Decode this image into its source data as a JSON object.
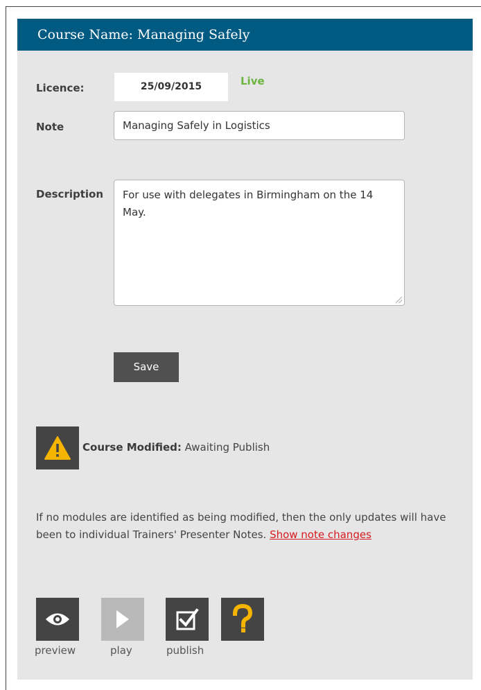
{
  "header": {
    "title": "Course Name: Managing Safely"
  },
  "licence": {
    "label": "Licence:",
    "date": "25/09/2015",
    "status": "Live",
    "status_color": "#6cb33f"
  },
  "note": {
    "label": "Note",
    "value": "Managing Safely in Logistics"
  },
  "description": {
    "label": "Description",
    "value": "For use with delegates in Birmingham on the 14 May."
  },
  "save": {
    "label": "Save"
  },
  "status": {
    "icon": "warning-icon",
    "label": "Course Modified:",
    "value": "Awaiting Publish"
  },
  "info": {
    "text": "If no modules are identified as being modified, then the only updates will have been to individual Trainers' Presenter Notes.",
    "link_label": "Show note changes"
  },
  "tools": [
    {
      "name": "preview",
      "label": "preview",
      "icon": "eye-icon"
    },
    {
      "name": "play",
      "label": "play",
      "icon": "play-icon"
    },
    {
      "name": "publish",
      "label": "publish",
      "icon": "checkbox-icon"
    },
    {
      "name": "help",
      "label": "",
      "icon": "question-icon"
    }
  ],
  "colors": {
    "header": "#015a82",
    "panel": "#e6e6e6",
    "warning": "#f5b400",
    "link": "#d71921"
  }
}
